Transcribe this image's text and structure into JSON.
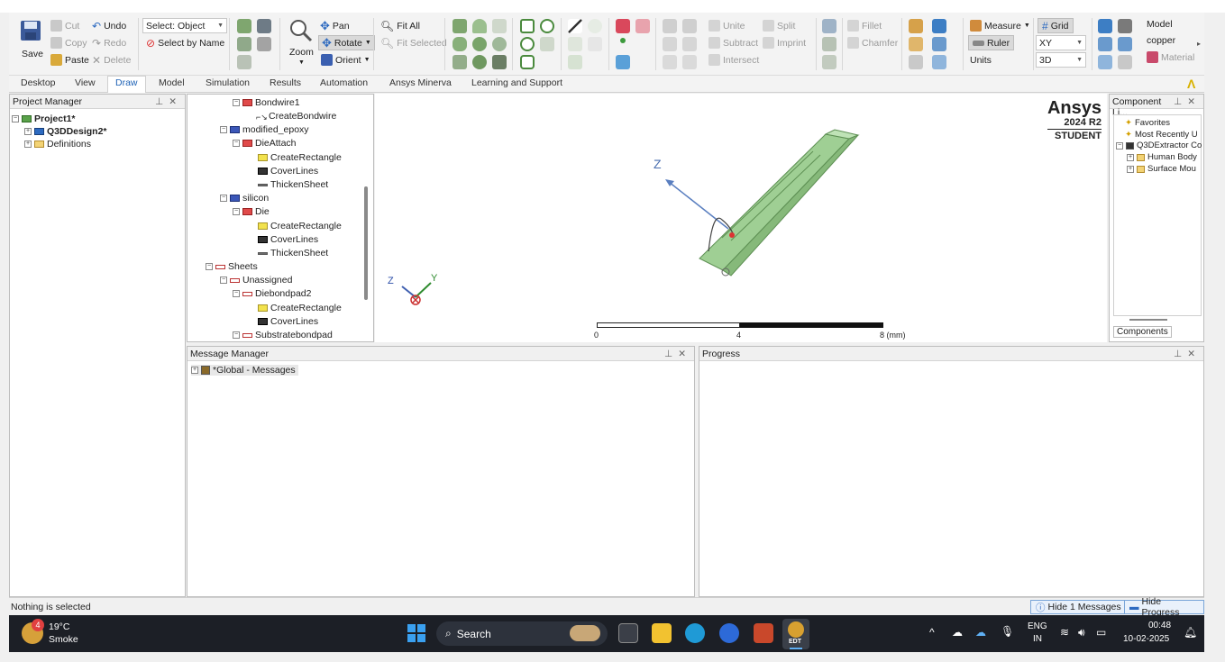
{
  "ribbon": {
    "save": "Save",
    "cut": "Cut",
    "copy": "Copy",
    "paste": "Paste",
    "undo": "Undo",
    "redo": "Redo",
    "delete": "Delete",
    "select_mode": "Select: Object",
    "select_by_name": "Select by Name",
    "zoom": "Zoom",
    "pan": "Pan",
    "rotate": "Rotate",
    "orient": "Orient",
    "fit_all": "Fit All",
    "fit_selected": "Fit Selected",
    "unite": "Unite",
    "subtract": "Subtract",
    "intersect": "Intersect",
    "split": "Split",
    "imprint": "Imprint",
    "fillet": "Fillet",
    "chamfer": "Chamfer",
    "measure": "Measure",
    "ruler": "Ruler",
    "units": "Units",
    "grid": "Grid",
    "plane": "XY",
    "dim": "3D",
    "model_label": "Model",
    "material_value": "copper",
    "material_btn": "Material"
  },
  "tabs": [
    "Desktop",
    "View",
    "Draw",
    "Model",
    "Simulation",
    "Results",
    "Automation",
    "Ansys Minerva",
    "Learning and Support"
  ],
  "active_tab": "Draw",
  "project_manager": {
    "title": "Project Manager",
    "project": "Project1*",
    "design": "Q3DDesign2*",
    "definitions": "Definitions"
  },
  "model_tree": [
    {
      "label": "Bondwire1",
      "icon": "object-icon"
    },
    {
      "label": "CreateBondwire",
      "icon": "bondwire-icon"
    },
    {
      "label": "modified_epoxy",
      "icon": "material-icon"
    },
    {
      "label": "DieAttach",
      "icon": "object-icon"
    },
    {
      "label": "CreateRectangle",
      "icon": "rectangle-icon"
    },
    {
      "label": "CoverLines",
      "icon": "cover-icon"
    },
    {
      "label": "ThickenSheet",
      "icon": "thicken-icon"
    },
    {
      "label": "silicon",
      "icon": "material-icon"
    },
    {
      "label": "Die",
      "icon": "object-icon"
    },
    {
      "label": "CreateRectangle",
      "icon": "rectangle-icon"
    },
    {
      "label": "CoverLines",
      "icon": "cover-icon"
    },
    {
      "label": "ThickenSheet",
      "icon": "thicken-icon"
    },
    {
      "label": "Sheets",
      "icon": "sheet-icon"
    },
    {
      "label": "Unassigned",
      "icon": "sheet-icon"
    },
    {
      "label": "Diebondpad2",
      "icon": "sheet-icon"
    },
    {
      "label": "CreateRectangle",
      "icon": "rectangle-icon"
    },
    {
      "label": "CoverLines",
      "icon": "cover-icon"
    },
    {
      "label": "Substratebondpad",
      "icon": "sheet-icon"
    }
  ],
  "viewport": {
    "brand": "Ansys",
    "version": "2024 R2",
    "edition": "STUDENT",
    "axis_z": "Z",
    "triad_z": "Z",
    "triad_y": "Y",
    "triad_x": "X",
    "scale_0": "0",
    "scale_4": "4",
    "scale_8": "8 (mm)"
  },
  "component_library": {
    "title": "Component Li...",
    "items": [
      "Favorites",
      "Most Recently U",
      "Q3DExtractor Co",
      "Human Body",
      "Surface Mou"
    ],
    "tab": "Components"
  },
  "message_manager": {
    "title": "Message Manager",
    "item": "*Global - Messages"
  },
  "progress": {
    "title": "Progress"
  },
  "status": {
    "text": "Nothing is selected",
    "hide_messages": "Hide 1 Messages",
    "hide_progress": "Hide Progress"
  },
  "taskbar": {
    "weather_temp": "19°C",
    "weather_desc": "Smoke",
    "weather_badge": "4",
    "search": "Search",
    "lang1": "ENG",
    "lang2": "IN",
    "time": "00:48",
    "date": "10-02-2025",
    "edt_label": "EDT"
  },
  "colors": {
    "accent": "#1e62b6",
    "model_green": "#a9d3a0",
    "taskbar": "#1c1f26"
  }
}
